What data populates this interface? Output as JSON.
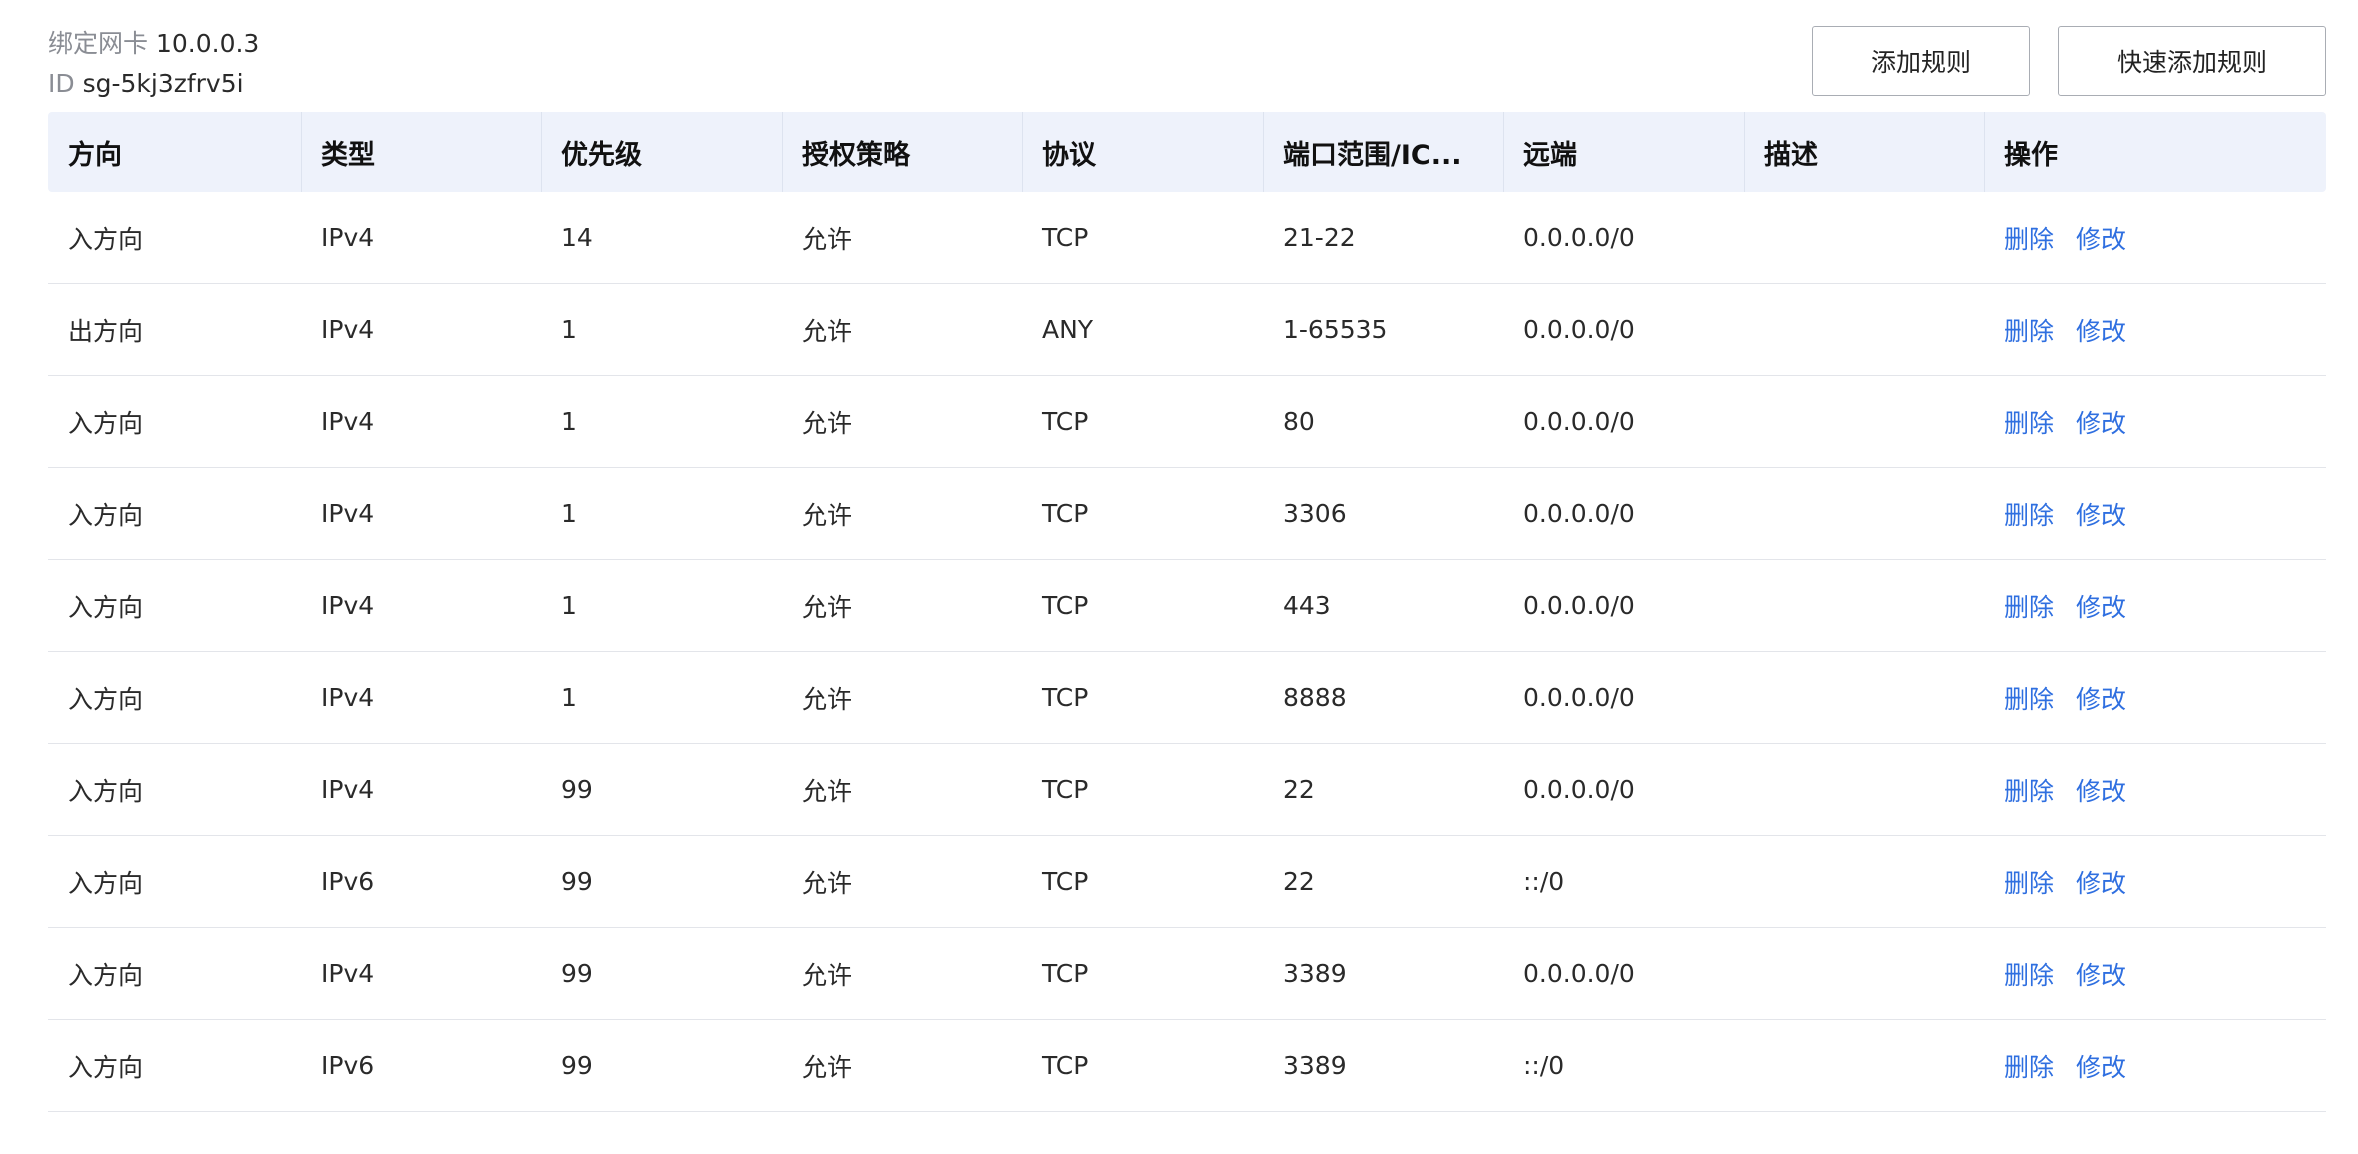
{
  "header": {
    "nic_label": "绑定网卡",
    "nic_value": "10.0.0.3",
    "id_label": "ID",
    "id_value": "sg-5kj3zfrv5i"
  },
  "toolbar": {
    "add_rule_label": "添加规则",
    "quick_add_rule_label": "快速添加规则"
  },
  "table": {
    "columns": [
      "方向",
      "类型",
      "优先级",
      "授权策略",
      "协议",
      "端口范围/IC...",
      "远端",
      "描述",
      "操作"
    ],
    "rows": [
      {
        "direction": "入方向",
        "type": "IPv4",
        "priority": "14",
        "policy": "允许",
        "protocol": "TCP",
        "port": "21-22",
        "remote": "0.0.0.0/0",
        "desc": "",
        "delete": "删除",
        "edit": "修改"
      },
      {
        "direction": "出方向",
        "type": "IPv4",
        "priority": "1",
        "policy": "允许",
        "protocol": "ANY",
        "port": "1-65535",
        "remote": "0.0.0.0/0",
        "desc": "",
        "delete": "删除",
        "edit": "修改"
      },
      {
        "direction": "入方向",
        "type": "IPv4",
        "priority": "1",
        "policy": "允许",
        "protocol": "TCP",
        "port": "80",
        "remote": "0.0.0.0/0",
        "desc": "",
        "delete": "删除",
        "edit": "修改"
      },
      {
        "direction": "入方向",
        "type": "IPv4",
        "priority": "1",
        "policy": "允许",
        "protocol": "TCP",
        "port": "3306",
        "remote": "0.0.0.0/0",
        "desc": "",
        "delete": "删除",
        "edit": "修改"
      },
      {
        "direction": "入方向",
        "type": "IPv4",
        "priority": "1",
        "policy": "允许",
        "protocol": "TCP",
        "port": "443",
        "remote": "0.0.0.0/0",
        "desc": "",
        "delete": "删除",
        "edit": "修改"
      },
      {
        "direction": "入方向",
        "type": "IPv4",
        "priority": "1",
        "policy": "允许",
        "protocol": "TCP",
        "port": "8888",
        "remote": "0.0.0.0/0",
        "desc": "",
        "delete": "删除",
        "edit": "修改"
      },
      {
        "direction": "入方向",
        "type": "IPv4",
        "priority": "99",
        "policy": "允许",
        "protocol": "TCP",
        "port": "22",
        "remote": "0.0.0.0/0",
        "desc": "",
        "delete": "删除",
        "edit": "修改"
      },
      {
        "direction": "入方向",
        "type": "IPv6",
        "priority": "99",
        "policy": "允许",
        "protocol": "TCP",
        "port": "22",
        "remote": "::/0",
        "desc": "",
        "delete": "删除",
        "edit": "修改"
      },
      {
        "direction": "入方向",
        "type": "IPv4",
        "priority": "99",
        "policy": "允许",
        "protocol": "TCP",
        "port": "3389",
        "remote": "0.0.0.0/0",
        "desc": "",
        "delete": "删除",
        "edit": "修改"
      },
      {
        "direction": "入方向",
        "type": "IPv6",
        "priority": "99",
        "policy": "允许",
        "protocol": "TCP",
        "port": "3389",
        "remote": "::/0",
        "desc": "",
        "delete": "删除",
        "edit": "修改"
      }
    ]
  },
  "colors": {
    "accent_link": "#2f6fe0",
    "header_bg": "#eef2fb",
    "row_border": "#e3e5ea"
  }
}
